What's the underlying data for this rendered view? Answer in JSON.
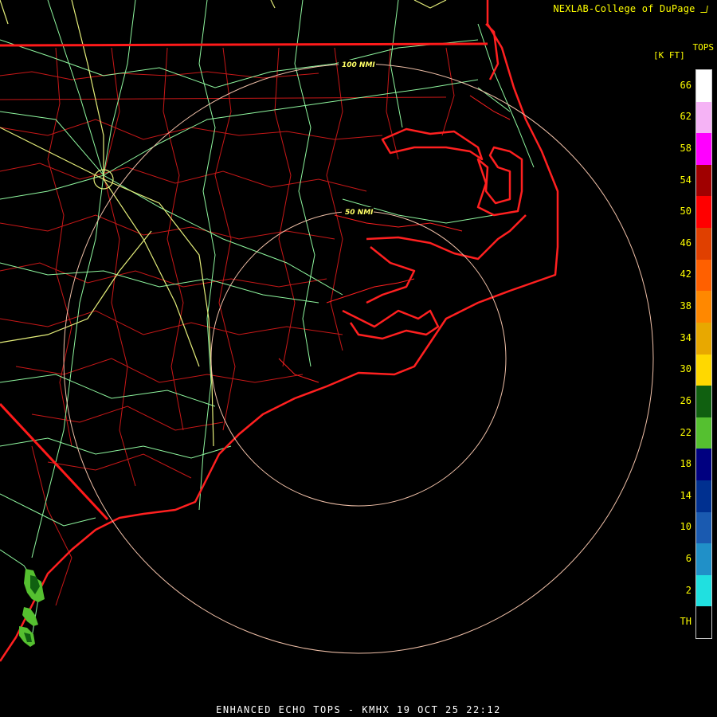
{
  "header": {
    "credit": "NEXLAB-College of DuPage ",
    "credit_icon": "nexlab-logo-icon"
  },
  "legend": {
    "title": "TOPS",
    "unit": "[K FT]",
    "ticks": [
      "66",
      "62",
      "58",
      "54",
      "50",
      "46",
      "42",
      "38",
      "34",
      "30",
      "26",
      "22",
      "18",
      "14",
      "10",
      "6",
      "2",
      "TH"
    ],
    "colors": [
      "#ffffff",
      "#f5b3f5",
      "#ff00ff",
      "#a00000",
      "#ff0000",
      "#e04000",
      "#ff6000",
      "#ff8800",
      "#e8a800",
      "#ffd800",
      "#106010",
      "#55c030",
      "#000080",
      "#003090",
      "#1a5ab0",
      "#2090c8",
      "#20e0e0",
      "#000000"
    ]
  },
  "rings": {
    "inner_label": "50 NMI",
    "outer_label": "100 NMI",
    "color": "#f0c0a8"
  },
  "map_colors": {
    "state_border": "#ff1a1a",
    "coastline": "#ff2020",
    "county_line": "#d01818",
    "highway": "#90ffa0",
    "interstate": "#e8f080",
    "echo_light": "#55c030",
    "echo_dark": "#106010"
  },
  "footer": {
    "product": "ENHANCED ECHO TOPS - KMHX 19 OCT 25 22:12"
  }
}
